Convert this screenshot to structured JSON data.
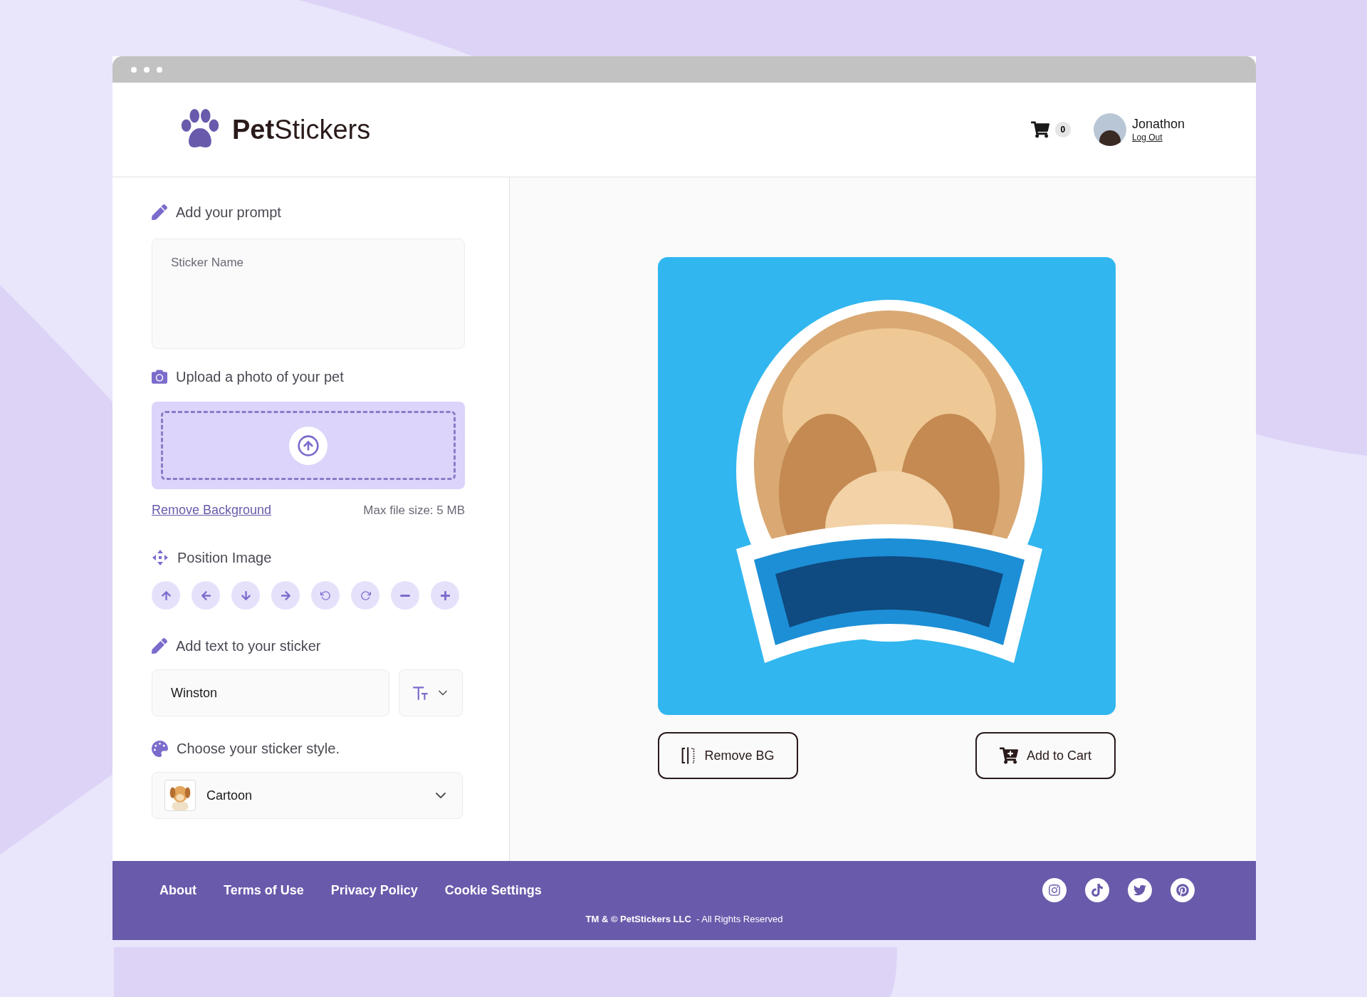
{
  "header": {
    "logo": "**Pet**Stickers",
    "cart_count": "0",
    "user": {
      "name": "Jonathon",
      "logout": "Log Out"
    }
  },
  "prompt": {
    "heading": "Add your prompt",
    "placeholder": "Sticker Name"
  },
  "upload": {
    "heading": "Upload a photo of your pet",
    "remove_link": "Remove Background",
    "max_size": "Max file size: 5 MB"
  },
  "position": {
    "heading": "Position Image",
    "controls": [
      {
        "kind": "up"
      },
      {
        "kind": "left"
      },
      {
        "kind": "down"
      },
      {
        "kind": "right"
      },
      {
        "kind": "rotate-left"
      },
      {
        "kind": "rotate-right"
      },
      {
        "kind": "zoom-out"
      },
      {
        "kind": "zoom-in"
      }
    ]
  },
  "text": {
    "heading": "Add text to your sticker",
    "value": "Winston"
  },
  "style": {
    "heading": "Choose your sticker style.",
    "value": "Cartoon"
  },
  "preview": {
    "buttons": [
      {
        "kind": "remove-bg",
        "label": "Remove BG"
      },
      {
        "kind": "add-to-cart",
        "label": "Add to Cart"
      }
    ]
  },
  "footer": {
    "links": [
      "About",
      "Terms of Use",
      "Privacy Policy",
      "Cookie Settings"
    ],
    "copyright": "**TM & © PetStickers LLC**  - All Rights Reserved",
    "social": [
      {
        "kind": "instagram"
      },
      {
        "kind": "tiktok"
      },
      {
        "kind": "twitter"
      },
      {
        "kind": "pinterest"
      }
    ]
  }
}
